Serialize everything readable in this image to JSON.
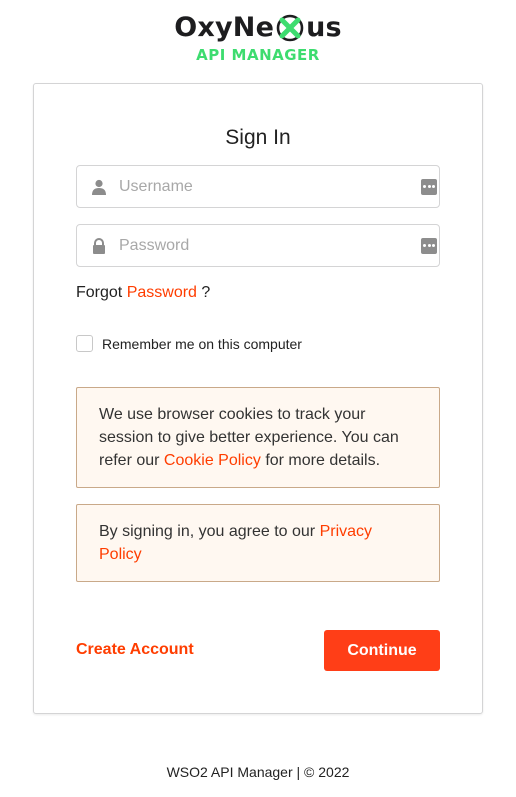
{
  "logo": {
    "name_prefix": "OxyNe",
    "name_suffix": "us",
    "subtitle": "API MANAGER",
    "accent_color": "#3ddc6f",
    "x_icon": "x-logo-icon"
  },
  "signin": {
    "title": "Sign In",
    "username_placeholder": "Username",
    "username_value": "",
    "password_placeholder": "Password",
    "password_value": "",
    "forgot_prefix": "Forgot",
    "forgot_link": "Password",
    "forgot_suffix": "?",
    "remember_label": "Remember me on this computer",
    "remember_checked": false
  },
  "notices": {
    "cookie_text_before": "We use browser cookies to track your session to give better experience. You can refer our",
    "cookie_link": "Cookie Policy",
    "cookie_text_after": "for more details.",
    "privacy_text_before": "By signing in, you agree to our",
    "privacy_link": "Privacy Policy"
  },
  "actions": {
    "create_account": "Create Account",
    "continue": "Continue"
  },
  "footer": {
    "text": "WSO2 API Manager | © 2022"
  },
  "colors": {
    "brand_orange": "#ff3e17",
    "link_orange": "#ff3d00",
    "notice_bg": "#fff8f1",
    "notice_border": "#c9a989",
    "logo_green": "#3ddc6f"
  },
  "icons": [
    "user-icon",
    "lock-icon",
    "password-manager-icon",
    "x-logo-icon"
  ]
}
